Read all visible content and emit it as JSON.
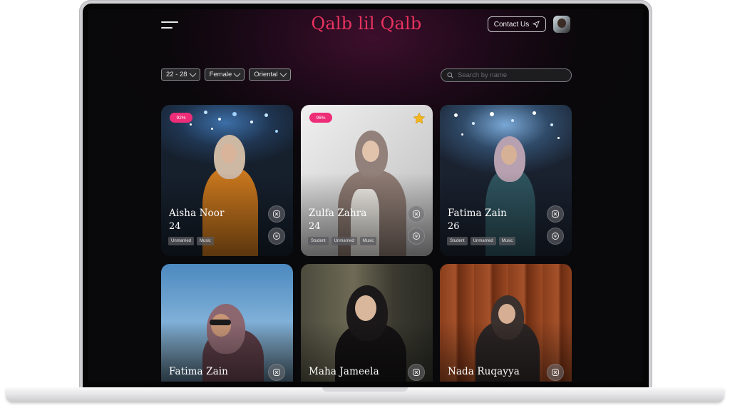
{
  "app": {
    "logo": "Qalb lil Qalb",
    "contact_label": "Contact Us",
    "brand_color": "#e8335f",
    "badge_color": "#ee2d78"
  },
  "filters": {
    "age_range": "22 - 28",
    "gender": "Female",
    "region": "Oriental"
  },
  "search": {
    "placeholder": "Search by name",
    "value": ""
  },
  "profiles": [
    {
      "name": "Aisha Noor",
      "age": "24",
      "match": "92%",
      "tags": [
        "Unmarried",
        "Music"
      ],
      "favorite": false
    },
    {
      "name": "Zulfa Zahra",
      "age": "24",
      "match": "96%",
      "tags": [
        "Student",
        "Unmarried",
        "Music"
      ],
      "favorite": true
    },
    {
      "name": "Fatima Zain",
      "age": "26",
      "match": "",
      "tags": [
        "Student",
        "Unmarried",
        "Music"
      ],
      "favorite": false
    },
    {
      "name": "Fatima Zain",
      "age": "",
      "match": "",
      "tags": [],
      "favorite": false
    },
    {
      "name": "Maha Jameela",
      "age": "",
      "match": "",
      "tags": [],
      "favorite": false
    },
    {
      "name": "Nada Ruqayya",
      "age": "",
      "match": "",
      "tags": [],
      "favorite": false
    }
  ],
  "icons": {
    "menu": "hamburger-icon",
    "send": "send-icon",
    "search": "search-icon",
    "dismiss": "close-circle-icon",
    "filter": "filter-icon",
    "favorite": "star-icon"
  }
}
